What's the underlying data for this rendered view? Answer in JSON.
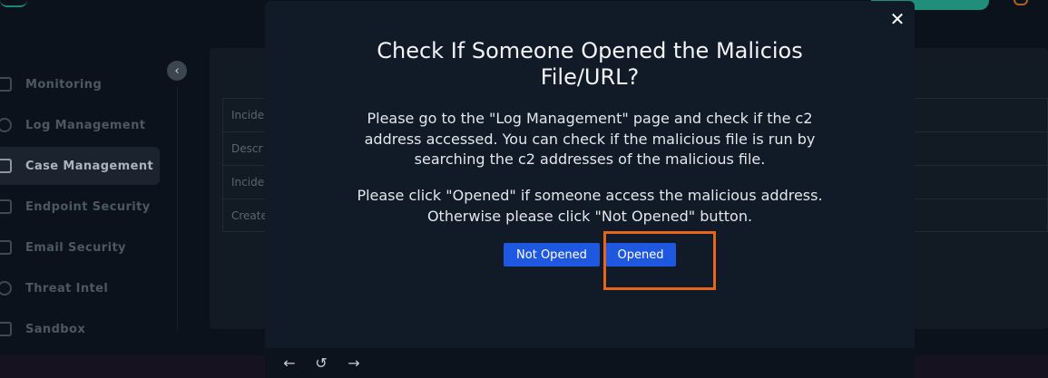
{
  "sidebar": {
    "items": [
      {
        "label": "Monitoring",
        "icon": "monitor-icon"
      },
      {
        "label": "Log Management",
        "icon": "search-icon"
      },
      {
        "label": "Case Management",
        "icon": "layers-icon",
        "active": true
      },
      {
        "label": "Endpoint Security",
        "icon": "server-icon"
      },
      {
        "label": "Email Security",
        "icon": "mail-icon"
      },
      {
        "label": "Threat Intel",
        "icon": "lifebuoy-icon"
      },
      {
        "label": "Sandbox",
        "icon": "cube-icon"
      }
    ]
  },
  "background_table": {
    "rows": [
      "Incide",
      "Descr",
      "Incide",
      "Create"
    ]
  },
  "modal": {
    "title": "Check If Someone Opened the Malicios File/URL?",
    "paragraph1": "Please go to the \"Log Management\" page and check if the c2 address accessed. You can check if the malicious file is run by searching the c2 addresses of the malicious file.",
    "paragraph2": "Please click \"Opened\" if someone access the malicious address. Otherwise please click \"Not Opened\" button.",
    "buttons": {
      "not_opened": "Not Opened",
      "opened": "Opened"
    },
    "close_icon": "close-icon"
  },
  "footer": {
    "icons": [
      "arrow-left-icon",
      "refresh-icon",
      "arrow-right-icon"
    ]
  },
  "colors": {
    "accent": "#1f58e0",
    "highlight": "#e8641a",
    "modal_bg": "#111b27"
  }
}
